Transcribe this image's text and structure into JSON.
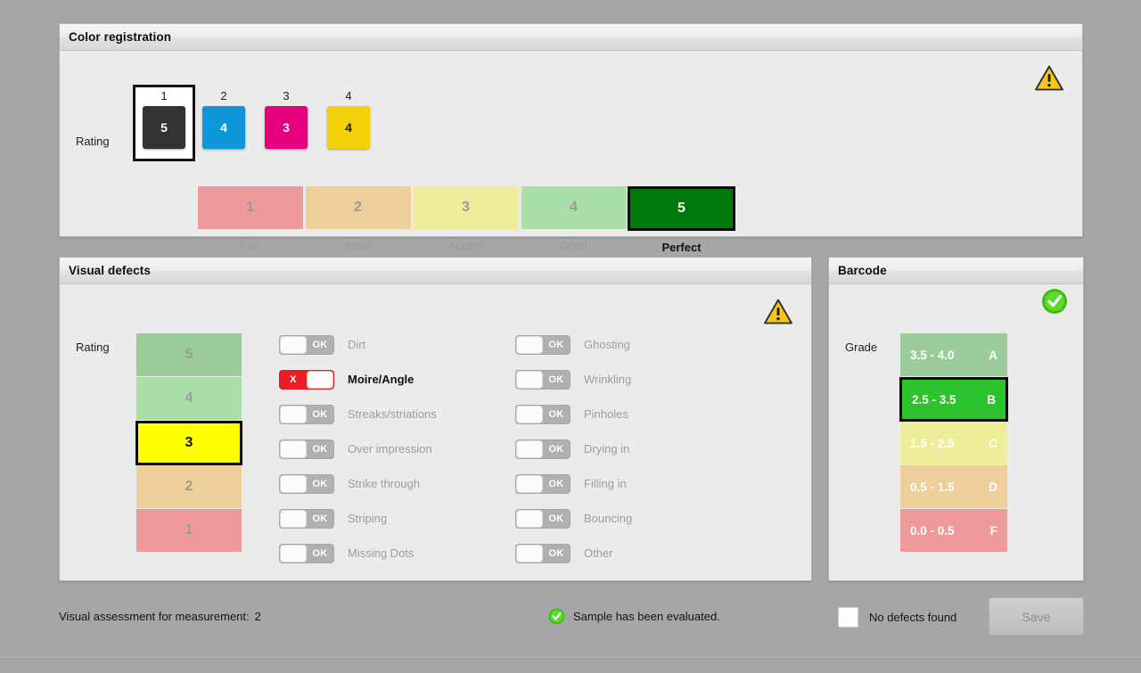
{
  "colors": {
    "background": "#a6a6a6",
    "panel_bg": "#ebebeb",
    "accent_selected_border": "#0a0a0a",
    "scale_fail": "#ef9a9a",
    "scale_warn": "#eecf9a",
    "scale_accept": "#eeee9a",
    "scale_good": "#a8e0a8",
    "scale_perfect_selected": "#00790c",
    "rating5_muted": "#9ccc9c",
    "rating3_selected": "#ffff00",
    "barcode_b_selected": "#2cc32c",
    "toggle_off": "#b0b0b0",
    "toggle_bad": "#ec1c24",
    "warning_yellow": "#f5c518",
    "ok_green": "#4fc61a"
  },
  "color_registration": {
    "title": "Color registration",
    "status_icon": "warning-triangle-icon",
    "rating_label": "Rating",
    "channels": [
      {
        "index": "1",
        "value": "5",
        "swatch_color": "#333333",
        "text_color": "#ffffff",
        "selected": true
      },
      {
        "index": "2",
        "value": "4",
        "swatch_color": "#0d96d8",
        "text_color": "#ffffff",
        "selected": false
      },
      {
        "index": "3",
        "value": "3",
        "swatch_color": "#e6007e",
        "text_color": "#ffffff",
        "selected": false
      },
      {
        "index": "4",
        "value": "4",
        "swatch_color": "#f2d10a",
        "text_color": "#1a1a1a",
        "selected": false
      }
    ],
    "scale": [
      {
        "value": "1",
        "caption": "Fail",
        "color": "#ef9a9a",
        "selected": false
      },
      {
        "value": "2",
        "caption": "Warn",
        "color": "#eecf9a",
        "selected": false
      },
      {
        "value": "3",
        "caption": "Accept",
        "color": "#eeee9a",
        "selected": false
      },
      {
        "value": "4",
        "caption": "Good",
        "color": "#a8e0a8",
        "selected": false
      },
      {
        "value": "5",
        "caption": "Perfect",
        "color": "#00790c",
        "selected": true
      }
    ]
  },
  "visual_defects": {
    "title": "Visual defects",
    "status_icon": "warning-triangle-icon",
    "rating_label": "Rating",
    "ratings": [
      {
        "value": "5",
        "color": "#9ccc9c",
        "selected": false
      },
      {
        "value": "4",
        "color": "#a8e0a8",
        "selected": false
      },
      {
        "value": "3",
        "color": "#ffff00",
        "selected": true
      },
      {
        "value": "2",
        "color": "#eecf9a",
        "selected": false
      },
      {
        "value": "1",
        "color": "#ef9a9a",
        "selected": false
      }
    ],
    "column_left": [
      {
        "label": "Dirt",
        "state": "OK",
        "flagged": false
      },
      {
        "label": "Moire/Angle",
        "state": "X",
        "flagged": true
      },
      {
        "label": "Streaks/striations",
        "state": "OK",
        "flagged": false
      },
      {
        "label": "Over impression",
        "state": "OK",
        "flagged": false
      },
      {
        "label": "Strike through",
        "state": "OK",
        "flagged": false
      },
      {
        "label": "Striping",
        "state": "OK",
        "flagged": false
      },
      {
        "label": "Missing Dots",
        "state": "OK",
        "flagged": false
      }
    ],
    "column_right": [
      {
        "label": "Ghosting",
        "state": "OK",
        "flagged": false
      },
      {
        "label": "Wrinkling",
        "state": "OK",
        "flagged": false
      },
      {
        "label": "Pinholes",
        "state": "OK",
        "flagged": false
      },
      {
        "label": "Drying in",
        "state": "OK",
        "flagged": false
      },
      {
        "label": "Filling in",
        "state": "OK",
        "flagged": false
      },
      {
        "label": "Bouncing",
        "state": "OK",
        "flagged": false
      },
      {
        "label": "Other",
        "state": "OK",
        "flagged": false
      }
    ]
  },
  "barcode": {
    "title": "Barcode",
    "status_icon": "check-circle-icon",
    "grade_label": "Grade",
    "grades": [
      {
        "range": "3.5 - 4.0",
        "letter": "A",
        "color": "#9ccc9c",
        "selected": false
      },
      {
        "range": "2.5 - 3.5",
        "letter": "B",
        "color": "#2cc32c",
        "selected": true
      },
      {
        "range": "1.5 - 2.5",
        "letter": "C",
        "color": "#eeee9a",
        "selected": false
      },
      {
        "range": "0.5 - 1.5",
        "letter": "D",
        "color": "#eecf9a",
        "selected": false
      },
      {
        "range": "0.0 - 0.5",
        "letter": "F",
        "color": "#ef9a9a",
        "selected": false
      }
    ]
  },
  "footer": {
    "assessment_label": "Visual assessment for measurement:",
    "assessment_value": "2",
    "evaluated_text": "Sample has been evaluated.",
    "evaluated_icon": "check-circle-icon",
    "no_defects_label": "No defects found",
    "no_defects_checked": false,
    "save_label": "Save",
    "save_enabled": false
  }
}
